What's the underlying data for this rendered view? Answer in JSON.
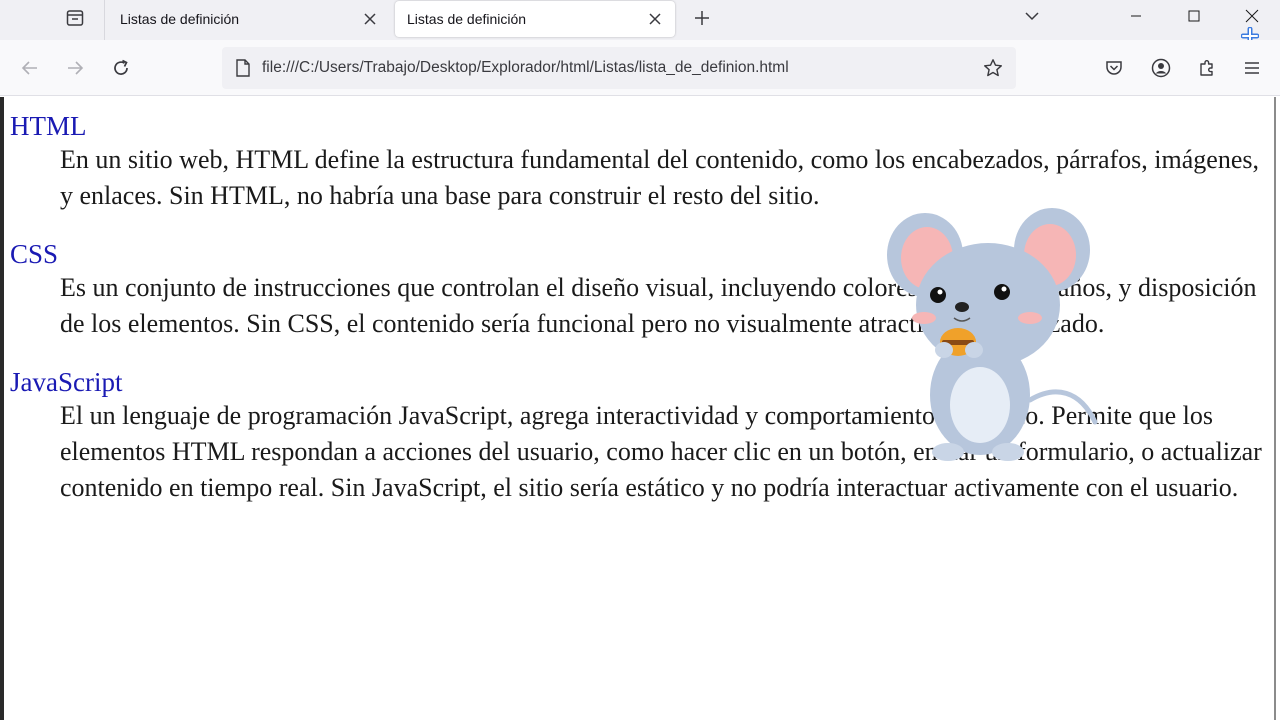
{
  "browser": {
    "tabs": [
      {
        "title": "Listas de definición",
        "active": false
      },
      {
        "title": "Listas de definición",
        "active": true
      }
    ],
    "url": "file:///C:/Users/Trabajo/Desktop/Explorador/html/Listas/lista_de_definion.html",
    "icons": {
      "tab_list": "list-all-tabs-icon",
      "close": "close-icon",
      "new_tab": "plus-icon",
      "dropdown": "chevron-down-icon",
      "back": "arrow-left-icon",
      "forward": "arrow-right-icon",
      "reload": "reload-icon",
      "page": "file-icon",
      "bookmark": "star-icon",
      "pocket": "pocket-icon",
      "account": "account-icon",
      "extensions": "puzzle-icon",
      "menu": "hamburger-menu-icon"
    }
  },
  "definitions": [
    {
      "term": "HTML",
      "description": "En un sitio web, HTML define la estructura fundamental del contenido, como los encabezados, párrafos, imágenes, y enlaces. Sin HTML, no habría una base para construir el resto del sitio."
    },
    {
      "term": "CSS",
      "description": "Es un conjunto de instrucciones que controlan el diseño visual, incluyendo colores, fuentes, tamaños, y disposición de los elementos. Sin CSS, el contenido sería funcional pero no visualmente atractivo ni organizado."
    },
    {
      "term": "JavaScript",
      "description": "El un lenguaje de programación JavaScript, agrega interactividad y comportamiento dinámico. Permite que los elementos HTML respondan a acciones del usuario, como hacer clic en un botón, enviar un formulario, o actualizar contenido en tiempo real. Sin JavaScript, el sitio sería estático y no podría interactuar activamente con el usuario."
    }
  ],
  "colors": {
    "term": "#1a1ab3",
    "text": "#1a1a1a",
    "tabstrip": "#f0f0f4",
    "toolbar": "#f9f9fb"
  }
}
